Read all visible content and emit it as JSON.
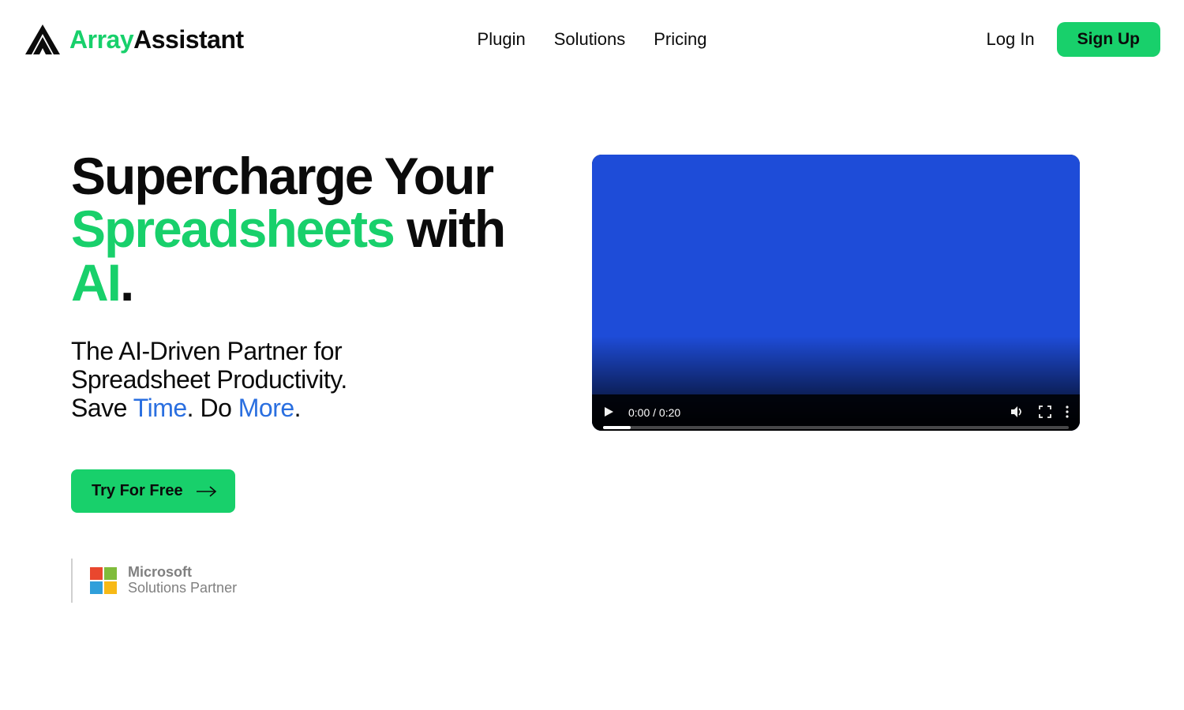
{
  "brand": {
    "word1": "Array",
    "word2": "Assistant"
  },
  "nav": {
    "plugin": "Plugin",
    "solutions": "Solutions",
    "pricing": "Pricing"
  },
  "auth": {
    "login": "Log In",
    "signup": "Sign Up"
  },
  "hero": {
    "headline": {
      "l1": "Supercharge Your",
      "spreadsheets": "Spreadsheets",
      "with": " with ",
      "ai": "AI",
      "dot": "."
    },
    "sub": {
      "l1": "The AI-Driven Partner for",
      "l2": "Spreadsheet Productivity.",
      "save": "Save ",
      "time": "Time",
      "do": ". Do ",
      "more": "More",
      "dot": "."
    },
    "cta": "Try For Free"
  },
  "partner": {
    "line1": "Microsoft",
    "line2": "Solutions Partner"
  },
  "video": {
    "time": "0:00 / 0:20"
  }
}
